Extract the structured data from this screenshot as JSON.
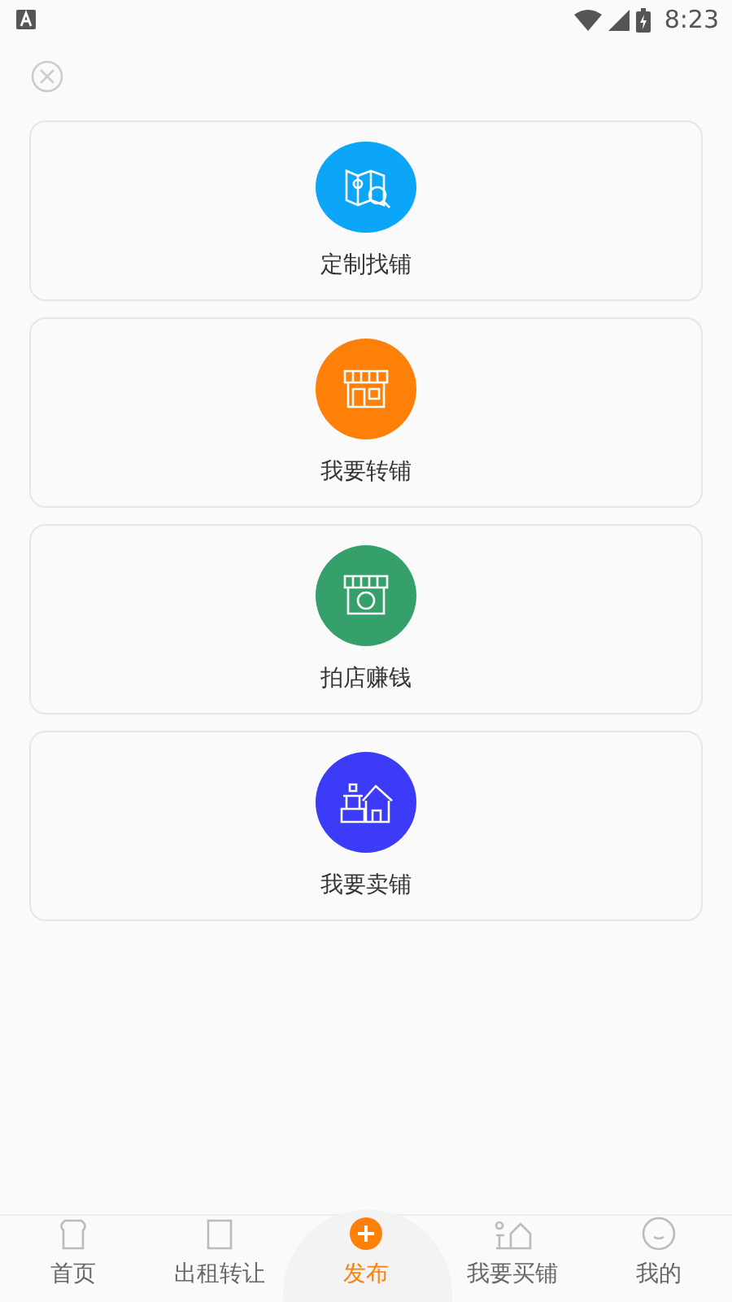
{
  "status_bar": {
    "time": "8:23"
  },
  "options": [
    {
      "label": "定制找铺",
      "kind": "map",
      "color": "#0ba6f8"
    },
    {
      "label": "我要转铺",
      "kind": "shop",
      "color": "#ff8009"
    },
    {
      "label": "拍店赚钱",
      "kind": "photo-shop",
      "color": "#36a06a"
    },
    {
      "label": "我要卖铺",
      "kind": "house",
      "color": "#3c3cf8"
    }
  ],
  "tab_bar": [
    {
      "label": "首页",
      "kind": "home",
      "selected": false
    },
    {
      "label": "出租转让",
      "kind": "rent",
      "selected": false
    },
    {
      "label": "发布",
      "kind": "publish",
      "selected": true
    },
    {
      "label": "我要买铺",
      "kind": "buy",
      "selected": false
    },
    {
      "label": "我的",
      "kind": "me",
      "selected": false
    }
  ]
}
